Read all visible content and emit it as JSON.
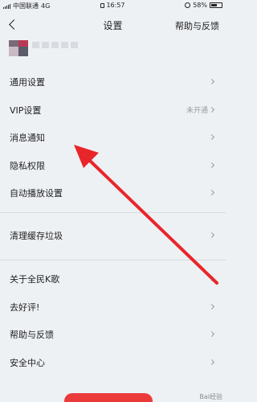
{
  "status_bar": {
    "carrier": "中国联通",
    "network": "4G",
    "time": "16:57",
    "battery": "58%",
    "battery_level": 0.58
  },
  "nav": {
    "title": "设置",
    "help_label": "帮助与反馈"
  },
  "menu": {
    "group1": [
      {
        "label": "通用设置",
        "value": ""
      },
      {
        "label": "VIP设置",
        "value": "未开通"
      },
      {
        "label": "消息通知",
        "value": ""
      },
      {
        "label": "隐私权限",
        "value": ""
      },
      {
        "label": "自动播放设置",
        "value": ""
      }
    ],
    "group2": [
      {
        "label": "清理缓存垃圾",
        "value": ""
      }
    ],
    "group3": [
      {
        "label": "关于全民K歌",
        "value": ""
      },
      {
        "label": "去好评!",
        "value": ""
      },
      {
        "label": "帮助与反馈",
        "value": ""
      },
      {
        "label": "安全中心",
        "value": ""
      }
    ]
  },
  "annotation": {
    "color": "#e8262a"
  },
  "watermark": "Bai经验"
}
